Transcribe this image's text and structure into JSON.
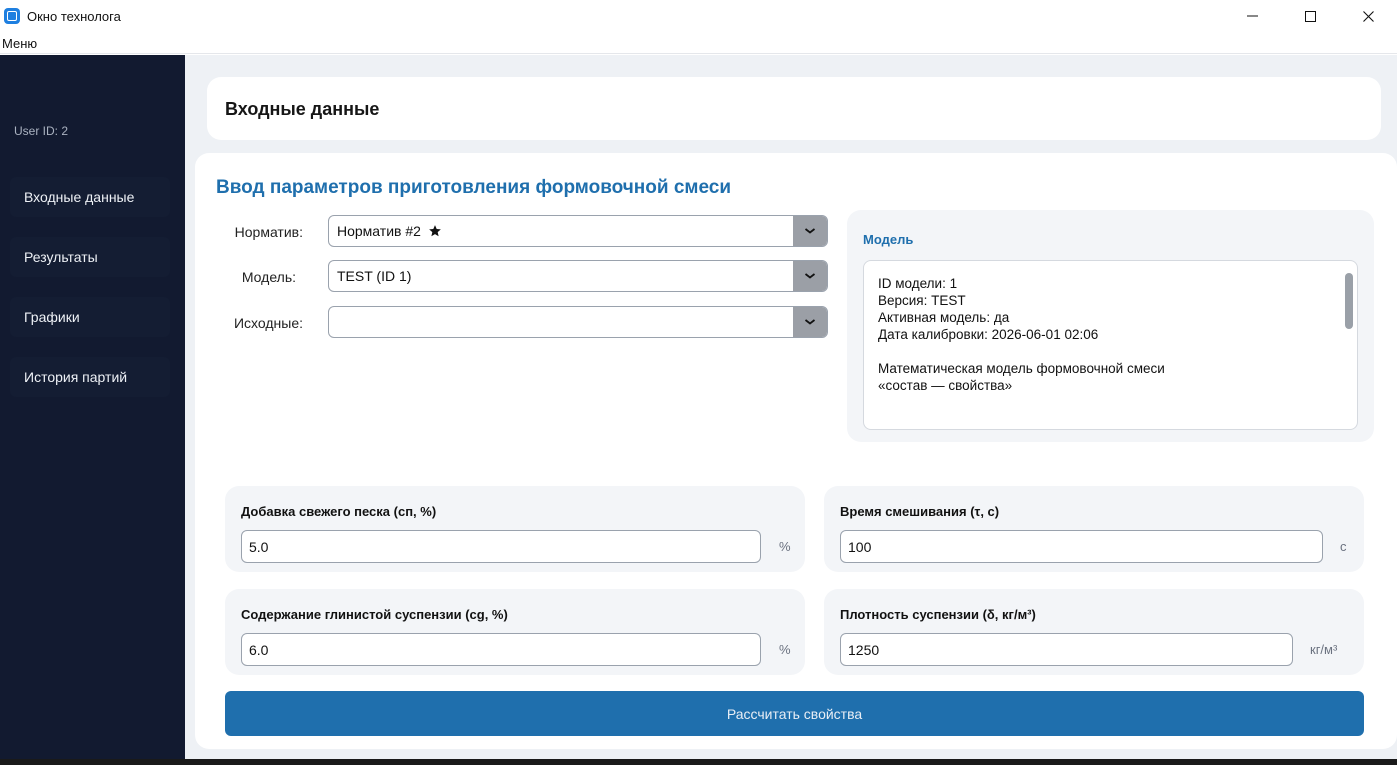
{
  "window": {
    "title": "Окно технолога",
    "minimize": "—",
    "maximize": "☐",
    "close": "✕"
  },
  "menu": {
    "label": "Меню"
  },
  "sidebar": {
    "user_id": "User ID: 2",
    "items": [
      {
        "label": "Входные данные"
      },
      {
        "label": "Результаты"
      },
      {
        "label": "Графики"
      },
      {
        "label": "История партий"
      }
    ]
  },
  "header": {
    "title": "Входные данные"
  },
  "form": {
    "section_title": "Ввод параметров приготовления формовочной смеси",
    "normative": {
      "label": "Норматив:",
      "value": "Норматив #2"
    },
    "model": {
      "label": "Модель:",
      "value": "TEST (ID 1)"
    },
    "source": {
      "label": "Исходные:",
      "value": ""
    }
  },
  "model_panel": {
    "title": "Модель",
    "lines": [
      "ID модели: 1",
      "Версия: TEST",
      "Активная модель: да",
      "Дата калибровки: 2026-06-01 02:06"
    ],
    "description": [
      "Математическая модель формовочной смеси",
      "«состав — свойства»"
    ]
  },
  "params": {
    "sand": {
      "label": "Добавка свежего песка (сп, %)",
      "value": "5.0",
      "unit": "%"
    },
    "mixing": {
      "label": "Время смешивания (τ, с)",
      "value": "100",
      "unit": "с"
    },
    "clay": {
      "label": "Содержание глинистой суспензии (cg, %)",
      "value": "6.0",
      "unit": "%"
    },
    "density": {
      "label": "Плотность суспензии (δ, кг/м³)",
      "value": "1250",
      "unit": "кг/м³"
    }
  },
  "actions": {
    "calculate": "Рассчитать свойства"
  },
  "colors": {
    "sidebar_bg": "#121a30",
    "accent": "#1f6fad",
    "main_bg": "#eef1f5"
  }
}
